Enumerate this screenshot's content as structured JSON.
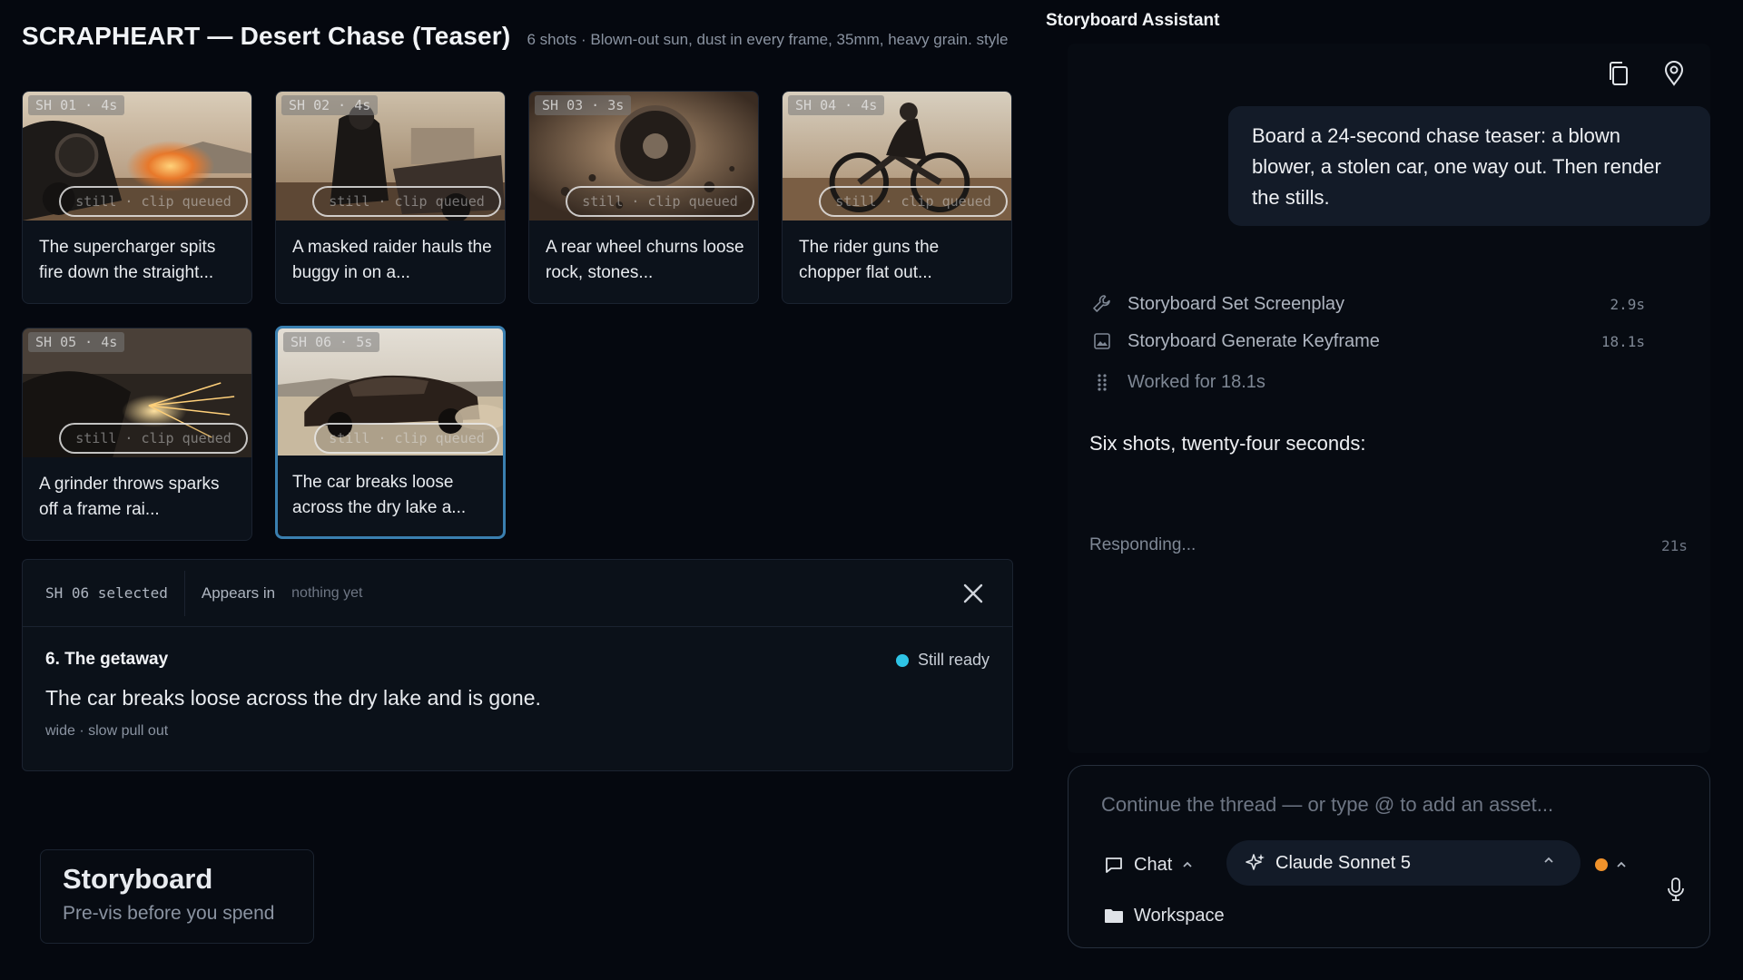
{
  "board": {
    "title": "SCRAPHEART — Desert Chase (Teaser)",
    "meta": "6 shots · Blown-out sun, dust in every frame, 35mm, heavy grain. style"
  },
  "shots": [
    {
      "tag": "SH 01 · 4s",
      "status": "still · clip queued",
      "caption": "The supercharger spits fire down the straight..."
    },
    {
      "tag": "SH 02 · 4s",
      "status": "still · clip queued",
      "caption": "A masked raider hauls the buggy in on a..."
    },
    {
      "tag": "SH 03 · 3s",
      "status": "still · clip queued",
      "caption": "A rear wheel churns loose rock, stones..."
    },
    {
      "tag": "SH 04 · 4s",
      "status": "still · clip queued",
      "caption": "The rider guns the chopper flat out..."
    },
    {
      "tag": "SH 05 · 4s",
      "status": "still · clip queued",
      "caption": "A grinder throws sparks off a frame rai..."
    },
    {
      "tag": "SH 06 · 5s",
      "status": "still · clip queued",
      "caption": "The car breaks loose across the dry lake a..."
    }
  ],
  "detail": {
    "selected": "SH 06 selected",
    "appears_label": "Appears in",
    "appears_value": "nothing yet",
    "title": "6. The getaway",
    "status": "Still ready",
    "status_color": "#2ec4e6",
    "description": "The car breaks loose across the dry lake and is gone.",
    "tags": "wide · slow pull out"
  },
  "brand": {
    "name": "Storyboard",
    "tagline": "Pre-vis before you spend"
  },
  "assistant": {
    "title": "Storyboard Assistant",
    "user_message": "Board a 24-second chase teaser: a blown blower, a stolen car, one way out. Then render the stills.",
    "tools": [
      {
        "icon": "wrench-icon",
        "label": "Storyboard Set Screenplay",
        "time": "2.9s"
      },
      {
        "icon": "image-icon",
        "label": "Storyboard Generate Keyframe",
        "time": "18.1s"
      }
    ],
    "worked": "Worked for 18.1s",
    "reply": "Six shots, twenty-four seconds:",
    "responding": "Responding...",
    "responding_time": "21s"
  },
  "composer": {
    "placeholder": "Continue the thread — or type @ to add an asset...",
    "mode": "Chat",
    "model": "Claude Sonnet 5",
    "workspace": "Workspace",
    "accent_dot": "#f0922b"
  }
}
